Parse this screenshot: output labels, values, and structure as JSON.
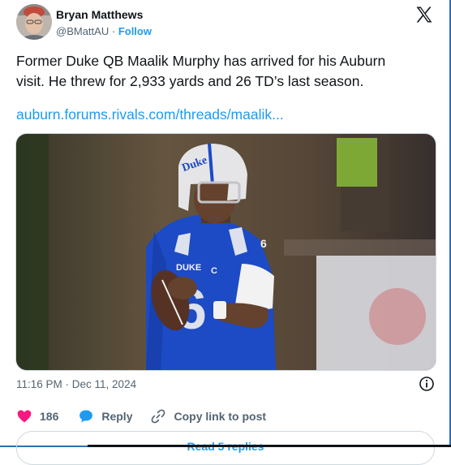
{
  "author": {
    "name": "Bryan Matthews",
    "handle": "@BMattAU",
    "separator": "·",
    "follow_label": "Follow"
  },
  "tweet": {
    "text": "Former Duke QB Maalik Murphy has arrived for his Auburn\nvisit. He threw for 2,933 yards and 26 TD’s last season.",
    "link": "auburn.forums.rivals.com/threads/maalik...",
    "media": {
      "jersey_school": "DUKE",
      "jersey_number": "6",
      "captain_patch": "C",
      "helmet_text": "Duke"
    },
    "timestamp": "11:16 PM · Dec 11, 2024"
  },
  "actions": {
    "like_count": "186",
    "reply_label": "Reply",
    "copy_link_label": "Copy link to post"
  },
  "replies_button_label": "Read 5 replies",
  "colors": {
    "accent": "#1d9bf0",
    "like": "#f91880",
    "text": "#0f1419",
    "muted": "#536471",
    "duke_blue": "#1f4fd0"
  },
  "icons": [
    "x-logo-icon",
    "info-icon",
    "heart-icon",
    "reply-bubble-icon",
    "link-icon"
  ]
}
